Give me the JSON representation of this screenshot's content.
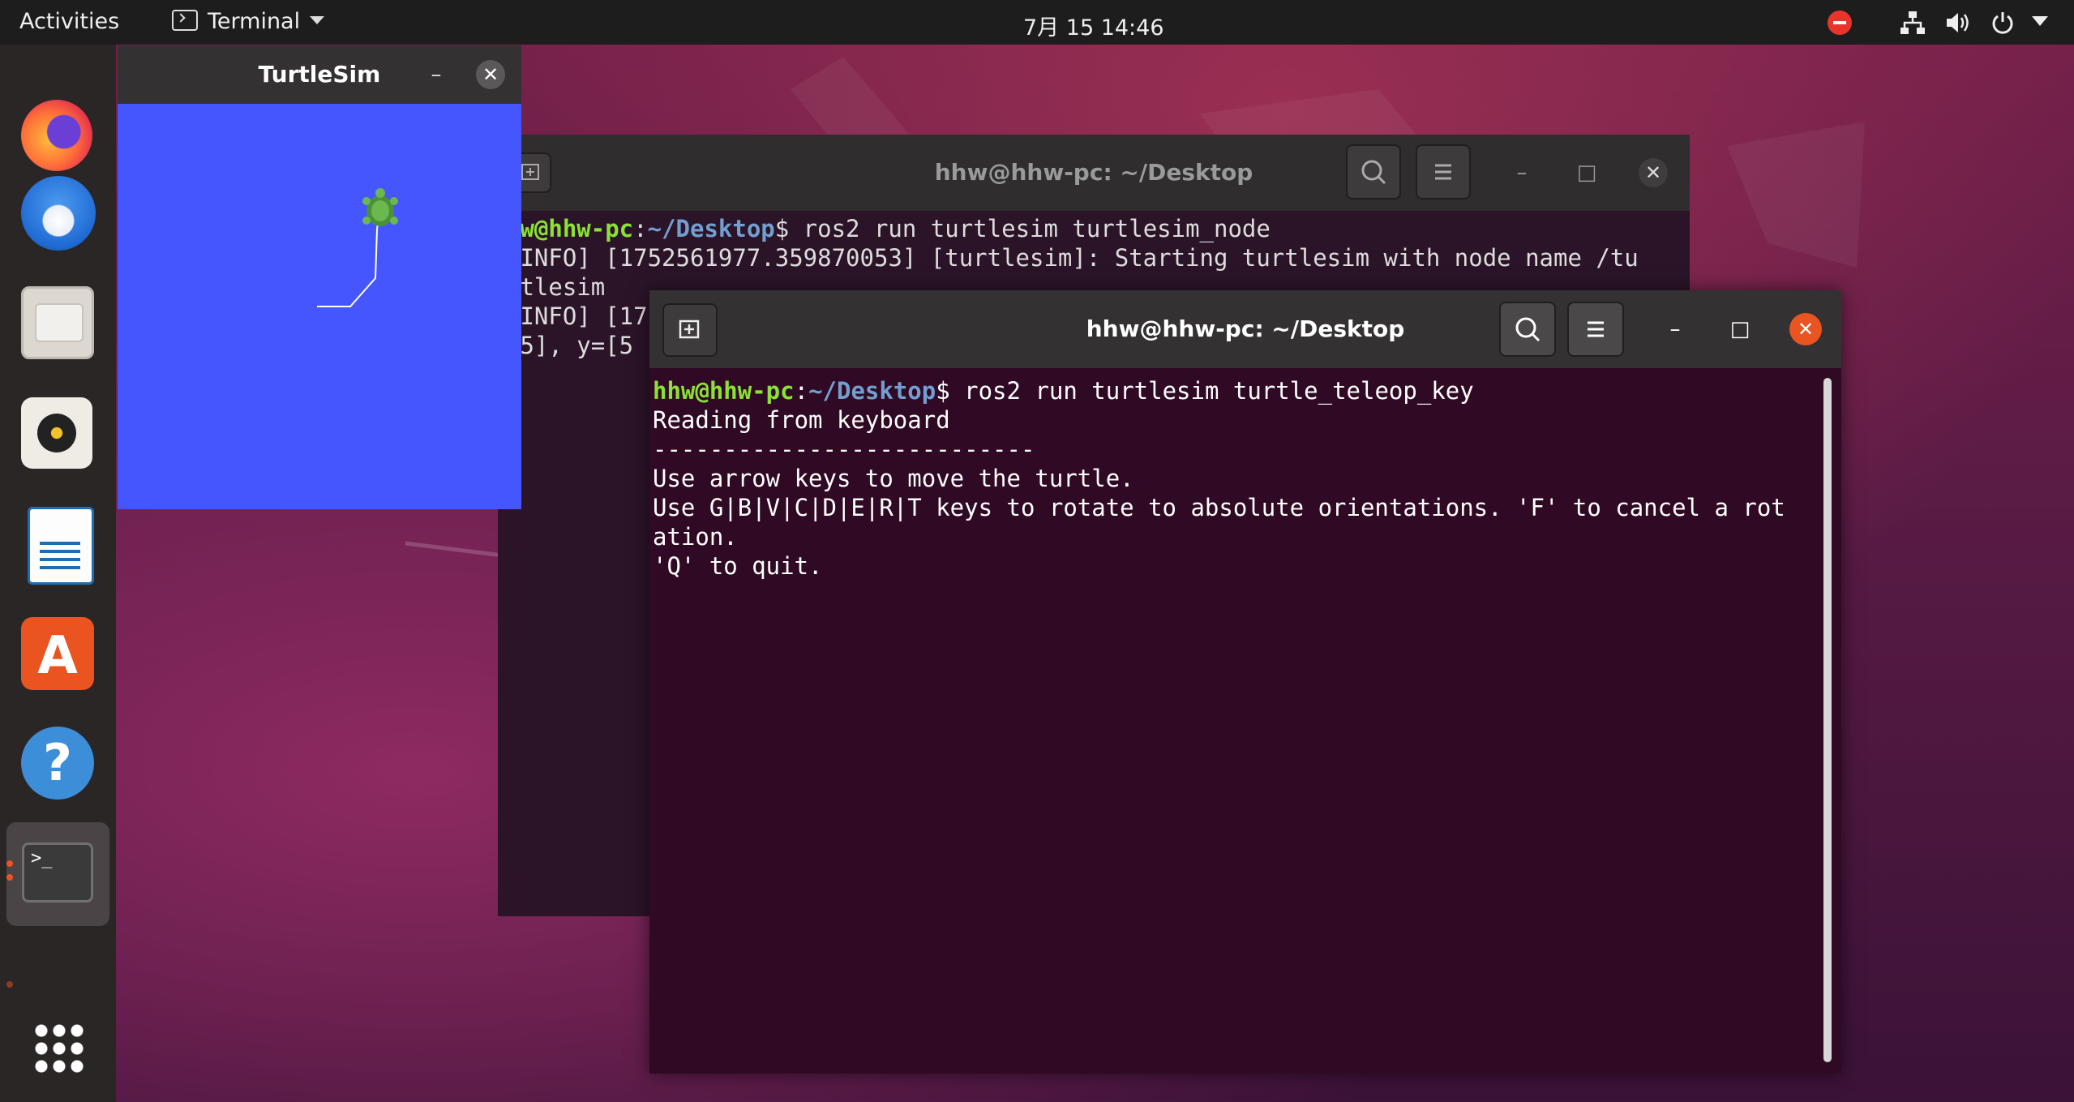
{
  "topbar": {
    "activities": "Activities",
    "app_menu": "Terminal",
    "clock": "7月 15  14:46"
  },
  "dock": {
    "items": [
      "firefox-icon",
      "thunderbird-icon",
      "files-icon",
      "rhythmbox-icon",
      "libreoffice-writer-icon",
      "ubuntu-software-icon",
      "help-icon",
      "terminal-icon"
    ],
    "help_glyph": "?",
    "software_glyph": "A",
    "terminal_glyph": ">_"
  },
  "turtlesim": {
    "title": "TurtleSim",
    "minimize": "–",
    "close": "✕",
    "background_color": "#4556ff",
    "trail_color": "#ffffff"
  },
  "terminal_back": {
    "title": "hhw@hhw-pc: ~/Desktop",
    "lines": [
      {
        "prompt_user": "hw@hhw-pc",
        "prompt_sep": ":",
        "prompt_path": "~/Desktop",
        "prompt_end": "$ ",
        "cmd": "ros2 run turtlesim turtlesim_node"
      },
      {
        "text": "[INFO] [1752561977.359870053] [turtlesim]: Starting turtlesim with node name /tu"
      },
      {
        "text": "rtlesim"
      },
      {
        "text": "[INFO] [17"
      },
      {
        "text": "45], y=[5"
      }
    ]
  },
  "terminal_front": {
    "title": "hhw@hhw-pc: ~/Desktop",
    "prompt_user": "hhw@hhw-pc",
    "prompt_sep": ":",
    "prompt_path": "~/Desktop",
    "prompt_end": "$ ",
    "command": "ros2 run turtlesim turtle_teleop_key",
    "output": [
      "Reading from keyboard",
      "---------------------------",
      "Use arrow keys to move the turtle.",
      "Use G|B|V|C|D|E|R|T keys to rotate to absolute orientations. 'F' to cancel a rot",
      "ation.",
      "'Q' to quit."
    ]
  },
  "window_buttons": {
    "minimize": "–",
    "maximize": "□",
    "close": "✕"
  },
  "colors": {
    "accent": "#e95420",
    "terminal_bg": "#300a24",
    "prompt_user": "#8ae234",
    "prompt_path": "#729fcf"
  }
}
